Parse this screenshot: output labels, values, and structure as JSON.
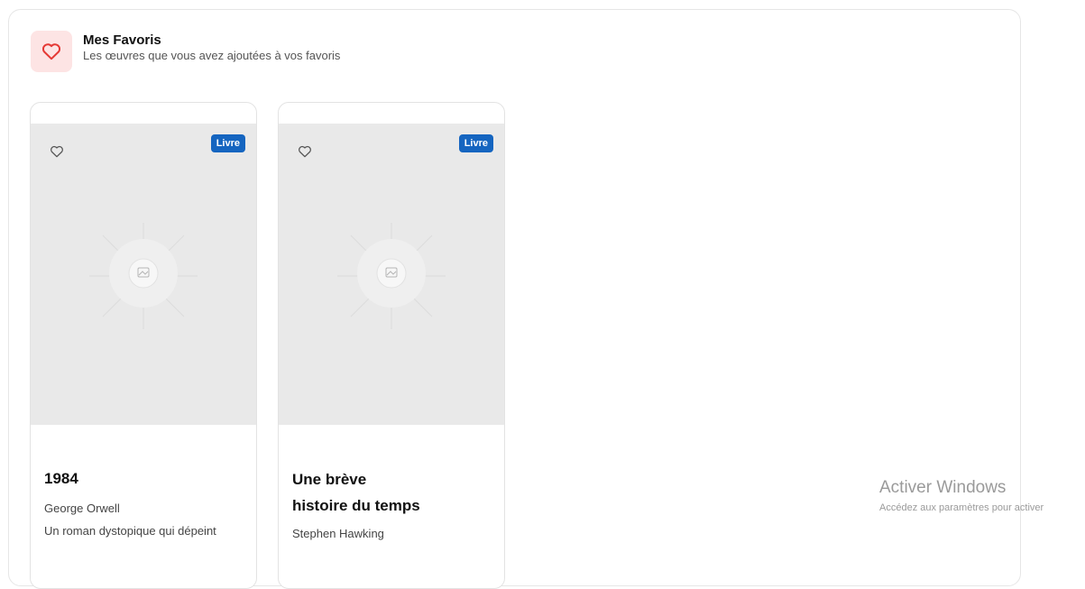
{
  "header": {
    "icon": "heart-icon",
    "title": "Mes Favoris",
    "subtitle": "Les œuvres que vous avez ajoutées à vos favoris"
  },
  "cards": [
    {
      "badge": "Livre",
      "title": "1984",
      "author": "George Orwell",
      "description": "Un roman dystopique qui dépeint"
    },
    {
      "badge": "Livre",
      "title_line1": "Une brève",
      "title_line2": "histoire du temps",
      "author": "Stephen Hawking"
    }
  ],
  "watermark": {
    "title": "Activer Windows",
    "subtitle": "Accédez aux paramètres pour activer"
  },
  "colors": {
    "accent_red": "#e53935",
    "header_icon_bg": "#fde4e4",
    "badge_blue": "#1565c0",
    "image_placeholder": "#e9e9e9"
  }
}
